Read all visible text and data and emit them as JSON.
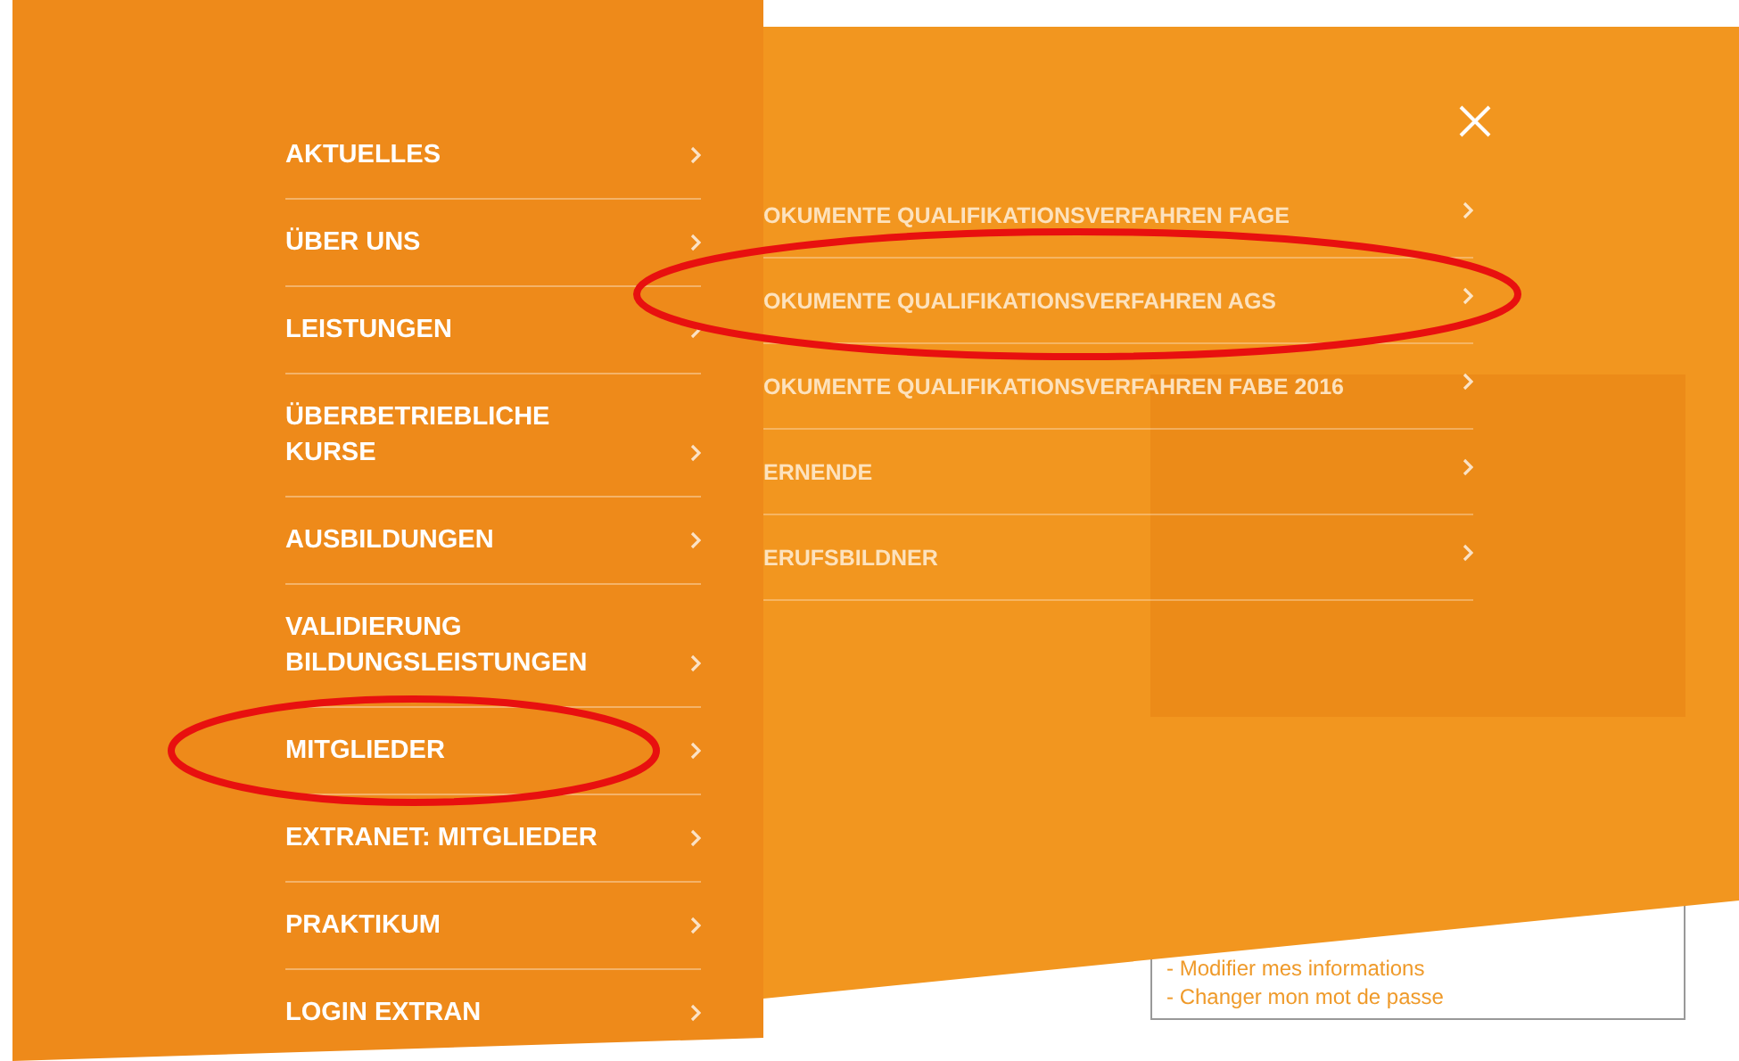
{
  "left_menu": {
    "items": [
      {
        "label": "AKTUELLES"
      },
      {
        "label": "ÜBER UNS"
      },
      {
        "label": "LEISTUNGEN"
      },
      {
        "label": "ÜBERBETRIEBLICHE KURSE"
      },
      {
        "label": "AUSBILDUNGEN"
      },
      {
        "label": "VALIDIERUNG BILDUNGSLEISTUNGEN"
      },
      {
        "label": "MITGLIEDER"
      },
      {
        "label": "EXTRANET: MITGLIEDER"
      },
      {
        "label": "PRAKTIKUM"
      },
      {
        "label": "LOGIN EXTRAN"
      }
    ]
  },
  "right_menu": {
    "items": [
      {
        "label": "OKUMENTE QUALIFIKATIONSVERFAHREN FAGE"
      },
      {
        "label": "OKUMENTE QUALIFIKATIONSVERFAHREN AGS"
      },
      {
        "label": "OKUMENTE QUALIFIKATIONSVERFAHREN FABE 2016"
      },
      {
        "label": "ERNENDE"
      },
      {
        "label": "ERUFSBILDNER"
      }
    ]
  },
  "page_behind": {
    "account_box": {
      "links": [
        "- Modifier mes informations",
        "- Changer mon mot de passe"
      ]
    }
  }
}
